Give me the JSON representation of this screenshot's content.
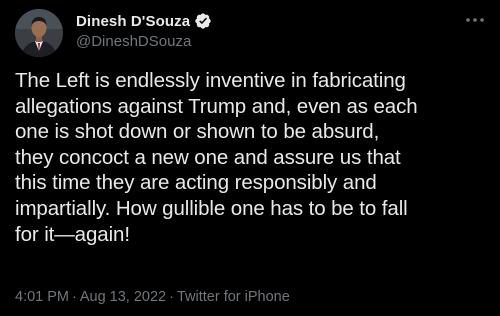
{
  "author": {
    "display_name": "Dinesh D'Souza",
    "handle": "@DineshDSouza",
    "verified": true
  },
  "tweet": {
    "text": "The Left is endlessly inventive in fabricating\nallegations against Trump and, even as each\none is shot down or shown to be absurd,\nthey concoct a new one and assure us that\nthis time they are acting responsibly and\nimpartially. How gullible one has to be to fall\nfor it—again!"
  },
  "meta": {
    "time": "4:01 PM",
    "separator": "·",
    "date": "Aug 13, 2022",
    "source": "Twitter for iPhone"
  },
  "icons": {
    "verified": "verified-badge-icon",
    "more": "more-options-icon"
  },
  "colors": {
    "background": "#000000",
    "primary_text": "#e7e9ea",
    "secondary_text": "#71767b",
    "verified": "#1d9bf0"
  }
}
